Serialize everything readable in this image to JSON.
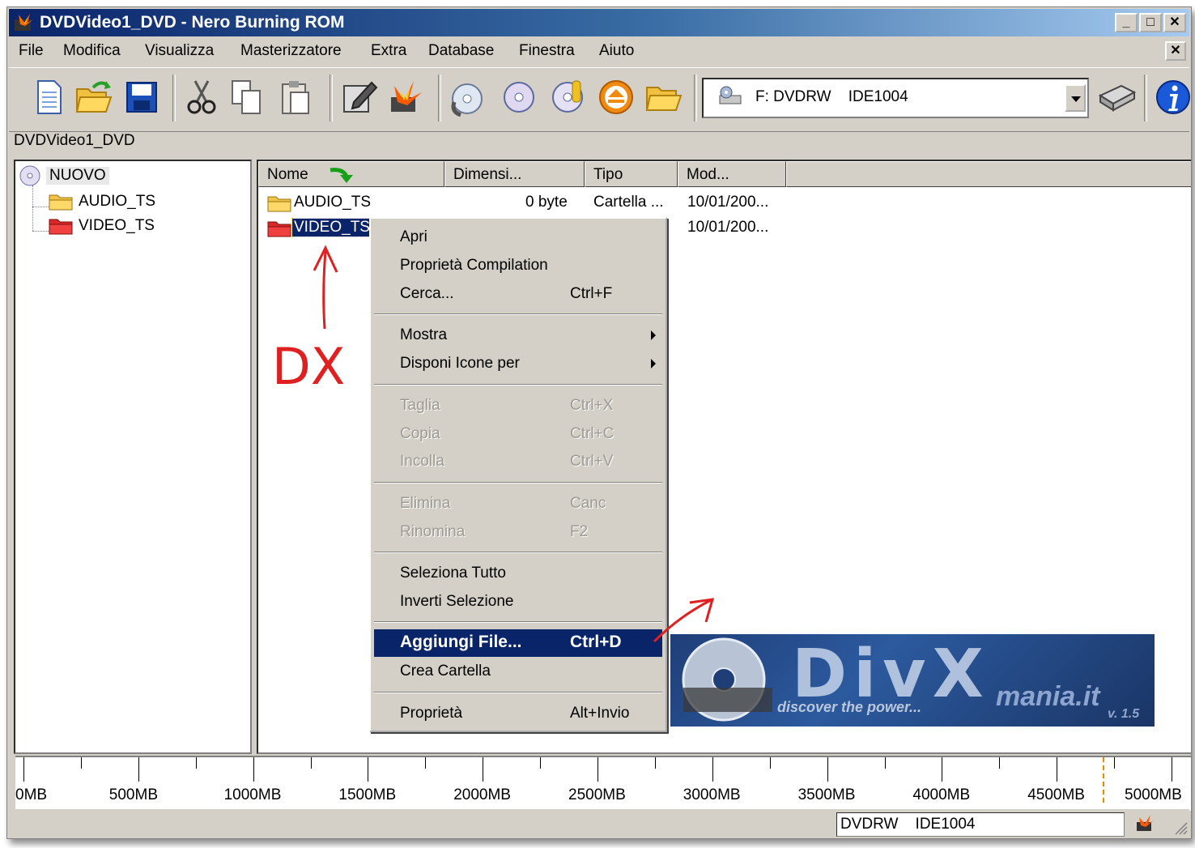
{
  "window": {
    "title": "DVDVideo1_DVD - Nero Burning ROM",
    "minimize": "_",
    "maximize": "□",
    "close": "✕"
  },
  "menu": [
    "File",
    "Modifica",
    "Visualizza",
    "Masterizzatore",
    "Extra",
    "Database",
    "Finestra",
    "Aiuto"
  ],
  "mdi_close": "✕",
  "toolbar": {
    "icons": [
      "new-document-icon",
      "open-folder-icon",
      "save-icon",
      "cut-icon",
      "copy-icon",
      "paste-icon",
      "write-compilation-icon",
      "burn-icon",
      "copy-disc-icon",
      "view-disc-icon",
      "disc-info-icon",
      "eject-icon",
      "browse-folder-icon",
      "drive-icon",
      "info-icon"
    ],
    "drive_select": "F: DVDRW    IDE1004"
  },
  "compilation_label": "DVDVideo1_DVD",
  "tree": {
    "root": "NUOVO",
    "children": [
      "AUDIO_TS",
      "VIDEO_TS"
    ]
  },
  "list": {
    "columns": [
      "Nome",
      "Dimensi...",
      "Tipo",
      "Mod..."
    ],
    "rows": [
      {
        "name": "AUDIO_TS",
        "size": "0 byte",
        "type": "Cartella ...",
        "modified": "10/01/200..."
      },
      {
        "name": "VIDEO_TS",
        "size": "",
        "type": "",
        "modified": "10/01/200..."
      }
    ]
  },
  "context_menu": [
    {
      "label": "Apri",
      "shortcut": "",
      "state": "enabled"
    },
    {
      "label": "Proprietà Compilation",
      "shortcut": "",
      "state": "enabled"
    },
    {
      "label": "Cerca...",
      "shortcut": "Ctrl+F",
      "state": "enabled"
    },
    {
      "label": "Mostra",
      "shortcut": "",
      "state": "enabled",
      "submenu": true
    },
    {
      "label": "Disponi Icone per",
      "shortcut": "",
      "state": "enabled",
      "submenu": true
    },
    {
      "label": "Taglia",
      "shortcut": "Ctrl+X",
      "state": "disabled"
    },
    {
      "label": "Copia",
      "shortcut": "Ctrl+C",
      "state": "disabled"
    },
    {
      "label": "Incolla",
      "shortcut": "Ctrl+V",
      "state": "disabled"
    },
    {
      "label": "Elimina",
      "shortcut": "Canc",
      "state": "disabled"
    },
    {
      "label": "Rinomina",
      "shortcut": "F2",
      "state": "disabled"
    },
    {
      "label": "Seleziona Tutto",
      "shortcut": "",
      "state": "enabled"
    },
    {
      "label": "Inverti Selezione",
      "shortcut": "",
      "state": "enabled"
    },
    {
      "label": "Aggiungi File...",
      "shortcut": "Ctrl+D",
      "state": "highlighted"
    },
    {
      "label": "Crea Cartella",
      "shortcut": "",
      "state": "enabled"
    },
    {
      "label": "Proprietà",
      "shortcut": "Alt+Invio",
      "state": "enabled"
    }
  ],
  "banner": {
    "logo": "DivX",
    "tagline": "discover the power...",
    "site": "mania.it",
    "version": "v. 1.5"
  },
  "capacity_ruler": {
    "labels": [
      "0MB",
      "500MB",
      "1000MB",
      "1500MB",
      "2000MB",
      "2500MB",
      "3000MB",
      "3500MB",
      "4000MB",
      "4500MB",
      "5000MB"
    ],
    "marker_mb": 4700
  },
  "status": {
    "drive": "DVDRW    IDE1004"
  },
  "annotation": {
    "text": "DX",
    "color": "#e02020"
  },
  "colors": {
    "selection": "#0a246a",
    "face": "#d4d0c8"
  }
}
